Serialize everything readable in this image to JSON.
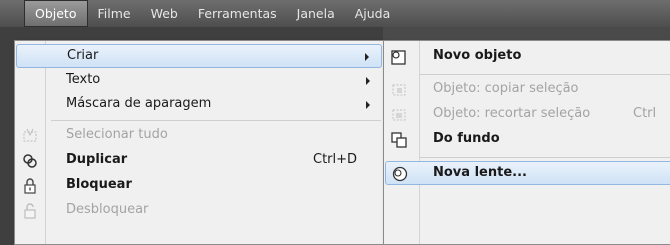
{
  "menubar": {
    "items": [
      "Objeto",
      "Filme",
      "Web",
      "Ferramentas",
      "Janela",
      "Ajuda"
    ]
  },
  "main_menu": {
    "items": [
      {
        "label": "Criar",
        "shortcut": "",
        "has_submenu": true,
        "state": "highlighted",
        "icon": ""
      },
      {
        "label": "Texto",
        "shortcut": "",
        "has_submenu": true,
        "state": "normal",
        "icon": ""
      },
      {
        "label": "Máscara de aparagem",
        "shortcut": "",
        "has_submenu": true,
        "state": "normal",
        "icon": ""
      },
      {
        "label": "Selecionar tudo",
        "shortcut": "",
        "has_submenu": false,
        "state": "disabled",
        "icon": "select-all-icon"
      },
      {
        "label": "Duplicar",
        "shortcut": "Ctrl+D",
        "has_submenu": false,
        "state": "normal",
        "icon": "duplicate-icon"
      },
      {
        "label": "Bloquear",
        "shortcut": "",
        "has_submenu": false,
        "state": "normal",
        "icon": "lock-icon"
      },
      {
        "label": "Desbloquear",
        "shortcut": "",
        "has_submenu": false,
        "state": "disabled",
        "icon": "unlock-icon"
      }
    ]
  },
  "sub_menu": {
    "items": [
      {
        "label": "Novo objeto",
        "shortcut": "",
        "state": "normal",
        "icon": "new-object-icon"
      },
      {
        "label": "Objeto: copiar seleção",
        "shortcut": "",
        "state": "disabled",
        "icon": "copy-selection-icon"
      },
      {
        "label": "Objeto: recortar seleção",
        "shortcut": "Ctrl",
        "state": "disabled",
        "icon": "cut-selection-icon"
      },
      {
        "label": "Do fundo",
        "shortcut": "",
        "state": "normal",
        "icon": "from-background-icon"
      },
      {
        "label": "Nova lente...",
        "shortcut": "",
        "state": "highlighted",
        "icon": "new-lens-icon"
      }
    ]
  }
}
